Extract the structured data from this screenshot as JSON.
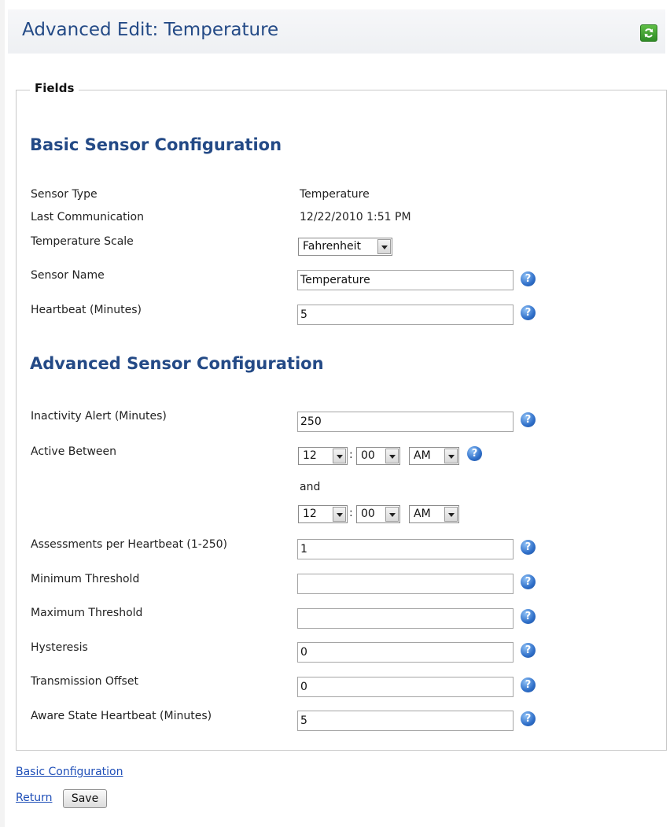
{
  "header": {
    "title": "Advanced Edit: Temperature",
    "refresh_icon": "refresh-icon"
  },
  "fieldset": {
    "legend": "Fields"
  },
  "basic": {
    "title": "Basic Sensor Configuration",
    "sensor_type": {
      "label": "Sensor Type",
      "value": "Temperature"
    },
    "last_communication": {
      "label": "Last Communication",
      "value": "12/22/2010 1:51 PM"
    },
    "temperature_scale": {
      "label": "Temperature Scale",
      "value": "Fahrenheit"
    },
    "sensor_name": {
      "label": "Sensor Name",
      "value": "Temperature"
    },
    "heartbeat": {
      "label": "Heartbeat (Minutes)",
      "value": "5"
    }
  },
  "advanced": {
    "title": "Advanced Sensor Configuration",
    "inactivity_alert": {
      "label": "Inactivity Alert (Minutes)",
      "value": "250"
    },
    "active_between": {
      "label": "Active Between",
      "start": {
        "hour": "12",
        "minute": "00",
        "ampm": "AM"
      },
      "and_label": "and",
      "end": {
        "hour": "12",
        "minute": "00",
        "ampm": "AM"
      }
    },
    "assessments": {
      "label": "Assessments per Heartbeat (1-250)",
      "value": "1"
    },
    "min_threshold": {
      "label": "Minimum Threshold",
      "value": ""
    },
    "max_threshold": {
      "label": "Maximum Threshold",
      "value": ""
    },
    "hysteresis": {
      "label": "Hysteresis",
      "value": "0"
    },
    "transmission_offset": {
      "label": "Transmission Offset",
      "value": "0"
    },
    "aware_state_heartbeat": {
      "label": "Aware State Heartbeat (Minutes)",
      "value": "5"
    }
  },
  "footer": {
    "basic_config_link": "Basic Configuration",
    "return_link": "Return",
    "save_label": "Save"
  },
  "help_glyph": "?",
  "time_separator": ":",
  "colors": {
    "title_blue": "#244a86",
    "link_blue": "#1f4fb8",
    "refresh_green": "#3a9a2e",
    "help_blue": "#2f6fc9"
  }
}
